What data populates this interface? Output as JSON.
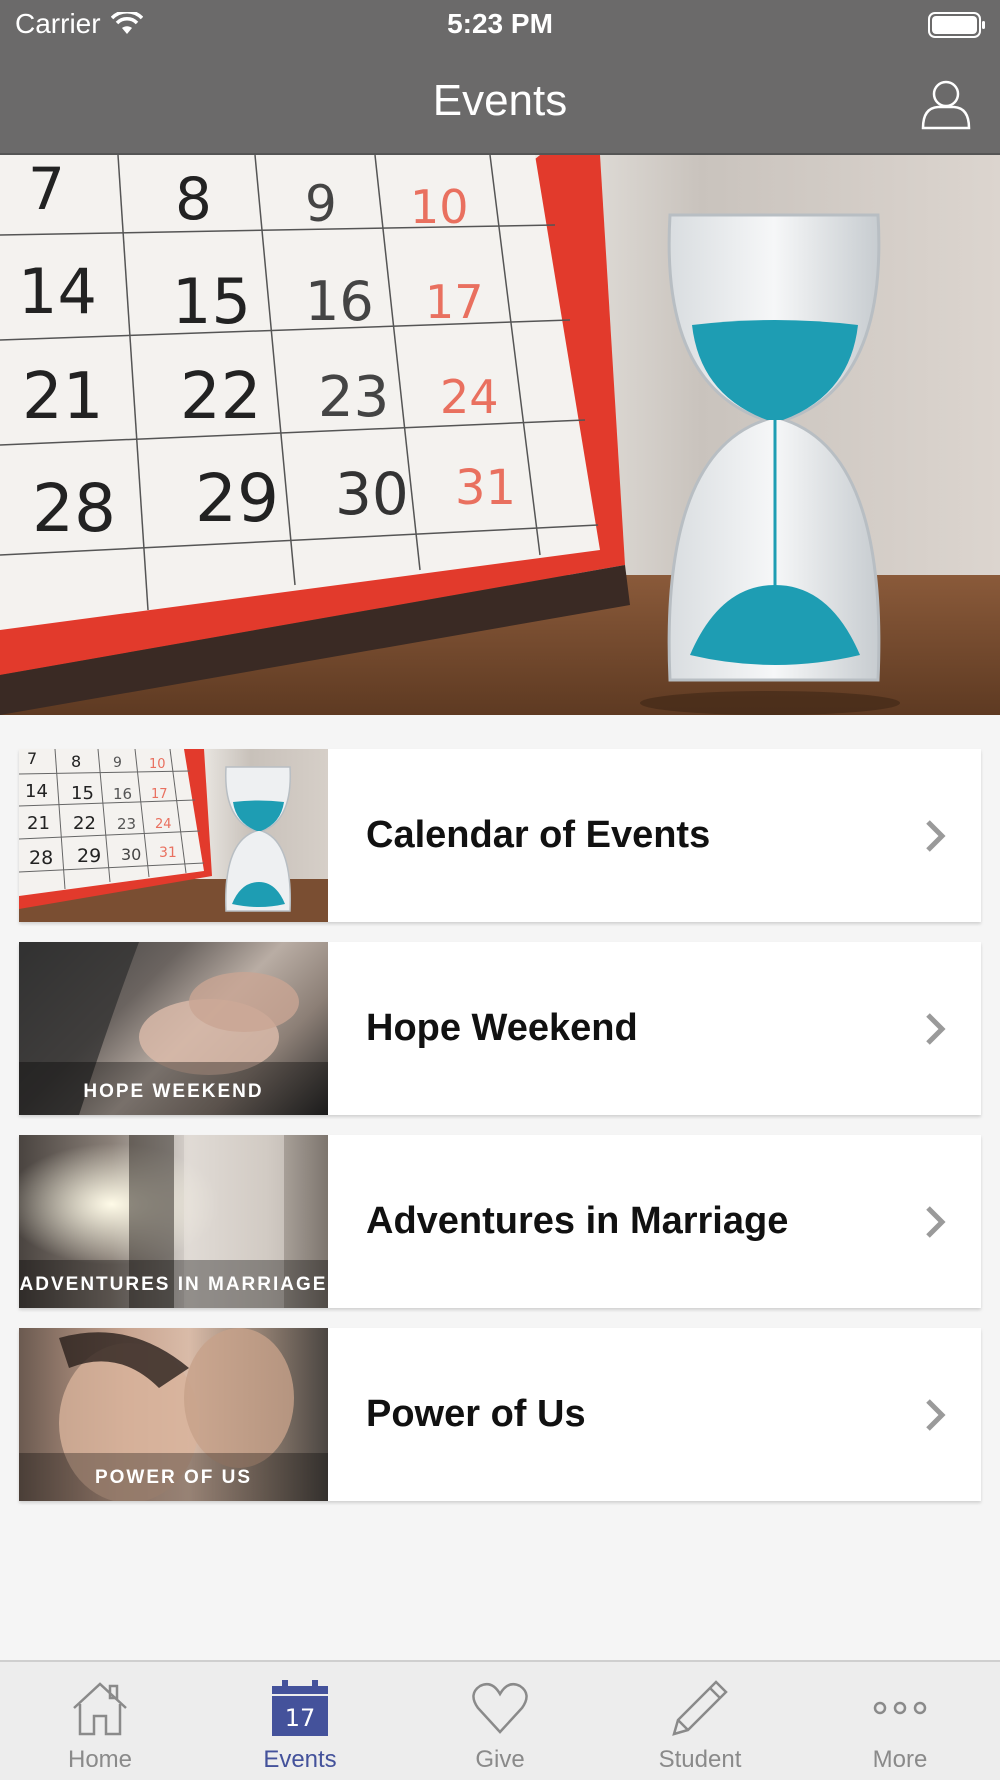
{
  "status_bar": {
    "carrier": "Carrier",
    "time": "5:23 PM"
  },
  "nav": {
    "title": "Events"
  },
  "hero": {
    "calendar_dates": [
      "7",
      "8",
      "9",
      "10",
      "14",
      "15",
      "16",
      "17",
      "21",
      "22",
      "23",
      "24",
      "28",
      "29",
      "30",
      "31"
    ]
  },
  "thumb_calendar_dates": [
    "7",
    "8",
    "9",
    "10",
    "14",
    "15",
    "16",
    "17",
    "21",
    "22",
    "23",
    "24",
    "28",
    "29",
    "30",
    "31"
  ],
  "list_items": [
    {
      "label": "Calendar of Events",
      "thumb_caption": ""
    },
    {
      "label": "Hope Weekend",
      "thumb_caption": "HOPE WEEKEND"
    },
    {
      "label": "Adventures in Marriage",
      "thumb_caption": "ADVENTURES IN MARRIAGE"
    },
    {
      "label": "Power of Us",
      "thumb_caption": "POWER OF US"
    }
  ],
  "tabs": [
    {
      "label": "Home",
      "icon": "home-icon",
      "active": false
    },
    {
      "label": "Events",
      "icon": "calendar-icon",
      "active": true,
      "icon_number": "17"
    },
    {
      "label": "Give",
      "icon": "heart-icon",
      "active": false
    },
    {
      "label": "Student",
      "icon": "pencil-icon",
      "active": false
    },
    {
      "label": "More",
      "icon": "more-icon",
      "active": false
    }
  ],
  "colors": {
    "nav_bg": "#6b6a6a",
    "tab_active": "#44529b",
    "tab_inactive": "#8a8a8a",
    "hourglass_sand": "#1e9db3",
    "calendar_red": "#e23a2c"
  }
}
